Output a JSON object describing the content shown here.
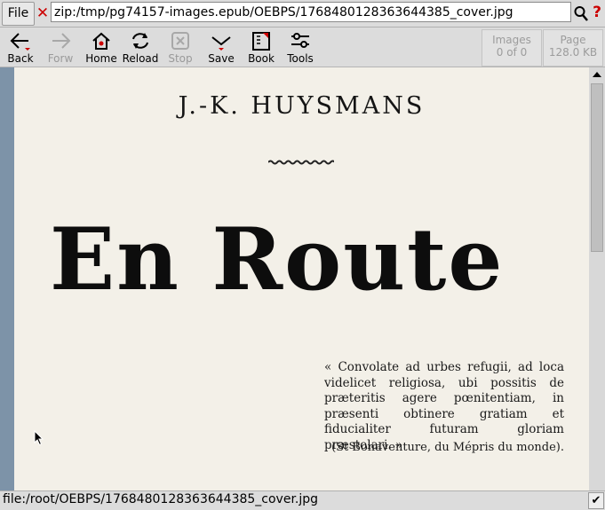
{
  "menu": {
    "file_label": "File"
  },
  "address": {
    "url": "zip:/tmp/pg74157-images.epub/OEBPS/1768480128363644385_cover.jpg"
  },
  "toolbar": {
    "back": "Back",
    "forward": "Forw",
    "home": "Home",
    "reload": "Reload",
    "stop": "Stop",
    "save": "Save",
    "book": "Book",
    "tools": "Tools"
  },
  "info": {
    "images_label": "Images",
    "images_value": "0 of 0",
    "page_label": "Page",
    "page_value": "128.0 KB"
  },
  "cover": {
    "author": "J.-K. HUYSMANS",
    "title": "En Route",
    "quote": "« Convolate ad urbes refugii, ad loca videlicet religiosa, ubi possitis de præteritis agere pœnitentiam, in præsenti obtinere gratiam et fiducialiter futuram gloriam præstolari. »",
    "attribution": "(St Bonaventure, du Mépris du monde)."
  },
  "status": {
    "text": "file:/root/OEBPS/1768480128363644385_cover.jpg"
  },
  "colors": {
    "accent_red": "#cc0000",
    "viewer_background": "#7d93a8",
    "page_paper": "#f3f0e8"
  }
}
